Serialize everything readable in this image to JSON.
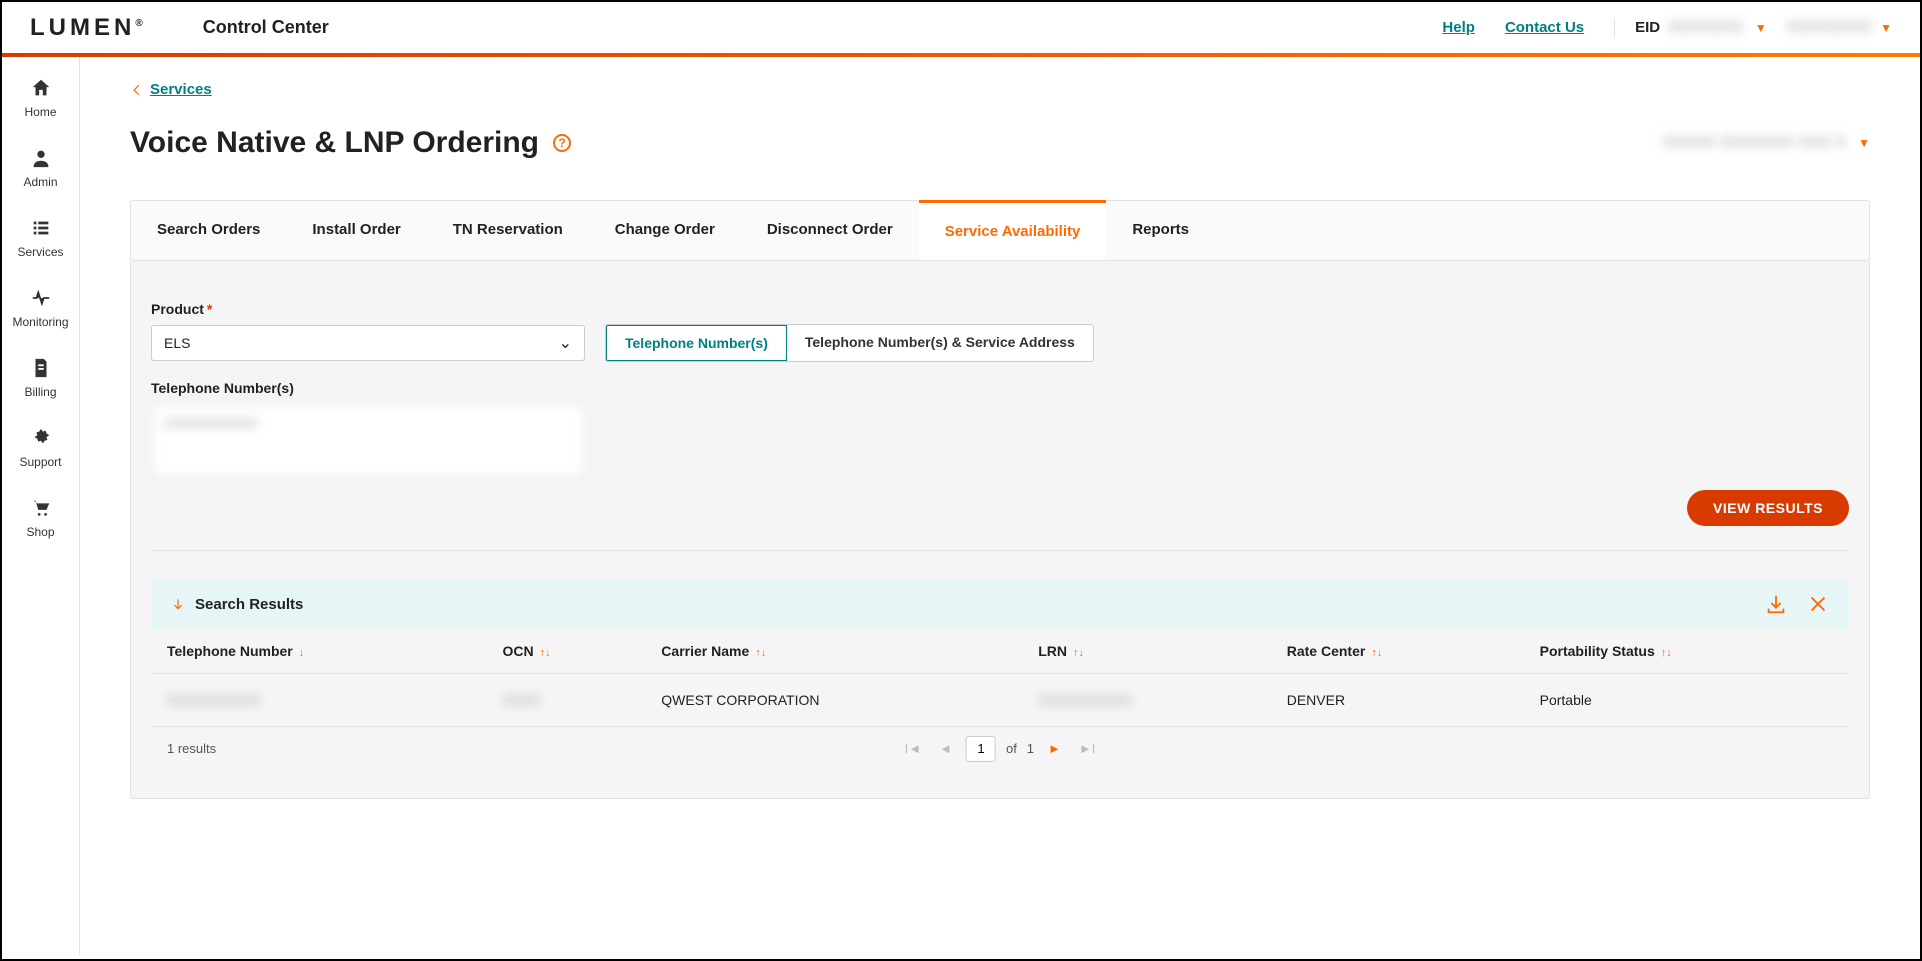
{
  "header": {
    "logo": "LUMEN",
    "logo_mark": "®",
    "subtitle": "Control Center",
    "help": "Help",
    "contact": "Contact Us",
    "eid_label": "EID",
    "eid_value": "XXXXXXX",
    "user_name": "XXXXXXXX"
  },
  "sidebar": {
    "items": [
      {
        "label": "Home",
        "icon": "home"
      },
      {
        "label": "Admin",
        "icon": "user"
      },
      {
        "label": "Services",
        "icon": "list"
      },
      {
        "label": "Monitoring",
        "icon": "pulse"
      },
      {
        "label": "Billing",
        "icon": "doc"
      },
      {
        "label": "Support",
        "icon": "gear"
      },
      {
        "label": "Shop",
        "icon": "cart"
      }
    ]
  },
  "breadcrumb": {
    "parent": "Services"
  },
  "page_title": "Voice Native & LNP Ordering",
  "account_selected": "XXXXX XXXXXXX XXX X",
  "tabs": [
    {
      "label": "Search Orders"
    },
    {
      "label": "Install Order"
    },
    {
      "label": "TN Reservation"
    },
    {
      "label": "Change Order"
    },
    {
      "label": "Disconnect Order"
    },
    {
      "label": "Service Availability",
      "active": true
    },
    {
      "label": "Reports"
    }
  ],
  "form": {
    "product_label": "Product",
    "product_value": "ELS",
    "seg_tn": "Telephone Number(s)",
    "seg_tn_addr": "Telephone Number(s) & Service Address",
    "tn_label": "Telephone Number(s)",
    "tn_value": "XXXXXXXXXX",
    "view_results": "VIEW RESULTS"
  },
  "results": {
    "heading": "Search Results",
    "columns": [
      "Telephone Number",
      "OCN",
      "Carrier Name",
      "LRN",
      "Rate Center",
      "Portability Status"
    ],
    "rows": [
      {
        "tn": "XXXXXXXXXX",
        "ocn": "XXXX",
        "carrier": "QWEST CORPORATION",
        "lrn": "XXXXXXXXXX",
        "rate_center": "DENVER",
        "portability": "Portable"
      }
    ],
    "count_text": "1 results",
    "page": "1",
    "of_label": "of",
    "total_pages": "1"
  }
}
